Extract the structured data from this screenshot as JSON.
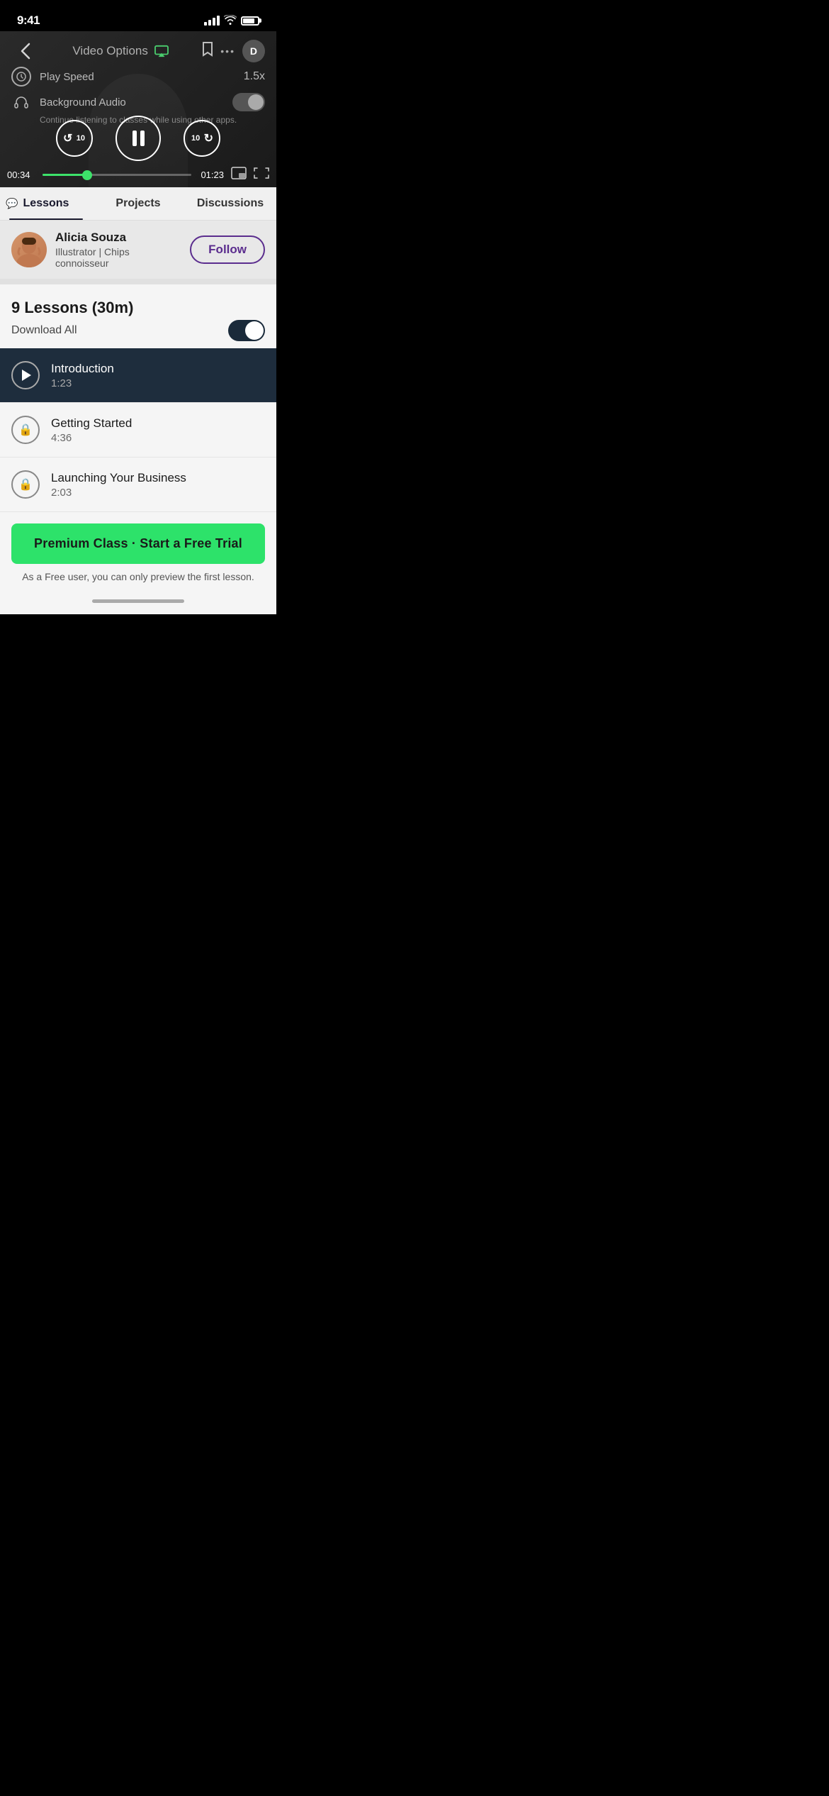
{
  "status_bar": {
    "time": "9:41",
    "battery_pct": 80
  },
  "nav_bar": {
    "title": "Video Options",
    "back_label": "‹",
    "bookmark_label": "🔖",
    "more_label": "•••"
  },
  "video": {
    "play_speed_label": "Play Speed",
    "speed_value": "1.5x",
    "bg_audio_label": "Background Audio",
    "bg_audio_desc": "Continue listening to classes while using other apps.",
    "time_current": "00:34",
    "time_total": "01:23",
    "rewind_seconds": "10",
    "forward_seconds": "10",
    "progress_pct": 30
  },
  "tabs": [
    {
      "id": "lessons",
      "label": "Lessons",
      "active": true
    },
    {
      "id": "projects",
      "label": "Projects",
      "active": false
    },
    {
      "id": "discussions",
      "label": "Discussions",
      "active": false
    }
  ],
  "instructor": {
    "name": "Alicia Souza",
    "title": "Illustrator | Chips connoisseur",
    "follow_label": "Follow"
  },
  "lessons_header": {
    "count_label": "9 Lessons (30m)",
    "download_label": "Download All"
  },
  "lessons": [
    {
      "id": 1,
      "title": "Introduction",
      "duration": "1:23",
      "type": "play",
      "active": true
    },
    {
      "id": 2,
      "title": "Getting Started",
      "duration": "4:36",
      "type": "lock",
      "active": false
    },
    {
      "id": 3,
      "title": "Launching Your Business",
      "duration": "2:03",
      "type": "lock",
      "active": false
    }
  ],
  "cta": {
    "btn_label": "Premium Class · Start a Free Trial",
    "subtext": "As a Free user, you can only preview the first lesson."
  }
}
